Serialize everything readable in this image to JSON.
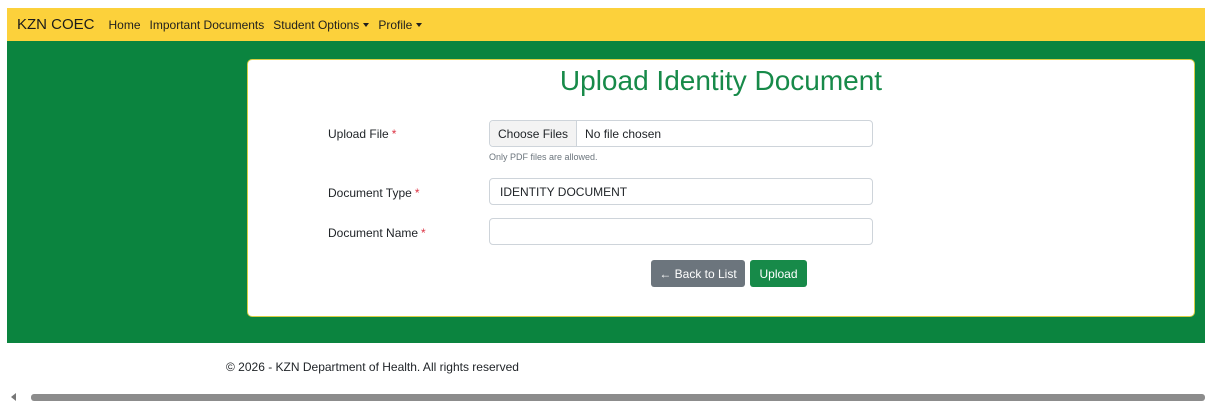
{
  "navbar": {
    "brand": "KZN COEC",
    "items": [
      {
        "label": "Home"
      },
      {
        "label": "Important Documents"
      },
      {
        "label": "Student Options"
      },
      {
        "label": "Profile"
      }
    ]
  },
  "form": {
    "title": "Upload Identity Document",
    "required_mark": "*",
    "upload_file": {
      "label": "Upload File",
      "button": "Choose Files",
      "status": "No file chosen",
      "help": "Only PDF files are allowed."
    },
    "document_type": {
      "label": "Document Type",
      "value": "IDENTITY DOCUMENT"
    },
    "document_name": {
      "label": "Document Name",
      "value": ""
    },
    "buttons": {
      "back": "← Back to List",
      "upload": "Upload"
    }
  },
  "footer": {
    "text": "© 2026 - KZN Department of Health. All rights reserved"
  },
  "colors": {
    "navbar": "#fcd13b",
    "band": "#0b843f",
    "accent": "#178a49",
    "secondary": "#6c757d",
    "required": "#dc3545"
  }
}
